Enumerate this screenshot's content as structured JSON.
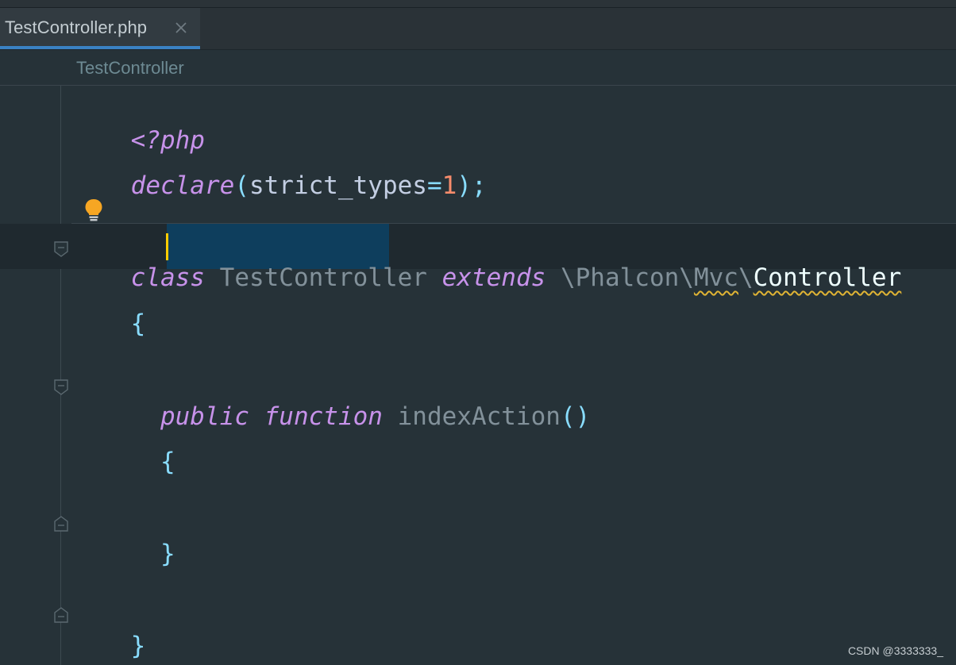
{
  "tab": {
    "title": "TestController.php",
    "close_icon": "close-icon"
  },
  "breadcrumb": {
    "text": "TestController"
  },
  "code": {
    "line1": "<?php",
    "line2": {
      "kw": "declare",
      "open": "(",
      "arg": "strict_types",
      "eq": "=",
      "num": "1",
      "close": ")",
      "semi": ";"
    },
    "class_line": {
      "kw_class": "class",
      "class_name": "TestController",
      "kw_extends": "extends",
      "ns_sep1": "\\",
      "ns1": "Phalcon",
      "ns_sep2": "\\",
      "ns2": "Mvc",
      "ns_sep3": "\\",
      "base": "Controller"
    },
    "class_open": "{",
    "method_line": {
      "kw_public": "public",
      "kw_function": "function",
      "name": "indexAction",
      "parens": "()"
    },
    "method_open": "{",
    "method_close": "}",
    "class_close": "}"
  },
  "icons": {
    "bulb": "lightbulb-icon",
    "fold": "fold-marker-icon"
  },
  "colors": {
    "background": "#263238",
    "keyword": "#c792ea",
    "punctuation": "#89ddff",
    "number": "#f78c6c",
    "selection": "#0e3e5d",
    "caret": "#ffcc00",
    "tab_accent": "#3a82c4"
  },
  "watermark": "CSDN @3333333_"
}
